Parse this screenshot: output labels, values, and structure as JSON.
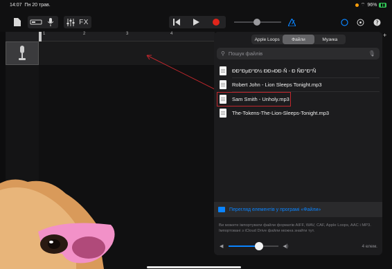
{
  "status_bar": {
    "time": "14:07",
    "date": "Пн 20 трав.",
    "battery": "96%"
  },
  "toolbar": {
    "fx_label": "FX"
  },
  "ruler": {
    "marks": [
      "1",
      "2",
      "3",
      "4",
      "5",
      "6"
    ]
  },
  "browser": {
    "tabs": [
      {
        "label": "Apple Loops",
        "active": false
      },
      {
        "label": "Файли",
        "active": true
      },
      {
        "label": "Музика",
        "active": false
      }
    ],
    "search_placeholder": "Пошук файлів",
    "files": [
      {
        "name": "ÐÐ°ÐµÐ°Ð½ ÐÐ»ÐÐ·Ñ - Ð ÑÐ°Ð°Ñ",
        "highlighted": false
      },
      {
        "name": "Robert John - Lion Sleeps Tonight.mp3",
        "highlighted": false
      },
      {
        "name": "Sam Smith - Unholy.mp3",
        "highlighted": true
      },
      {
        "name": "The-Tokens-The-Lion-Sleeps-Tonight.mp3",
        "highlighted": false
      }
    ],
    "browse_link": "Перегляд елементів у програмі «Файли»",
    "info_text": "Ви можете імпортувати файли форматів AIFF, WAV, CAF, Apple Loops, AAC і MP3. Імпортовані з iCloud Drive файли можна знайти тут.",
    "volume_level": 0.6,
    "item_count": "4 елем."
  },
  "colors": {
    "accent": "#0a84ff",
    "record": "#e0251b",
    "highlight_box": "#c1272d"
  }
}
